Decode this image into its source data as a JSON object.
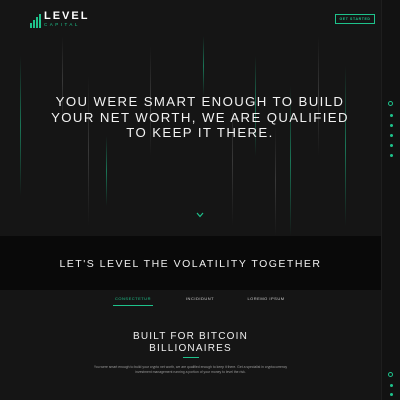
{
  "brand": {
    "name": "LEVEL",
    "tagline": "CAPITAL",
    "accent": "#1ec28b",
    "background": "#151515",
    "band_background": "#090909"
  },
  "header": {
    "cta_label": "GET STARTED"
  },
  "hero": {
    "title": "YOU WERE SMART ENOUGH TO BUILD YOUR NET WORTH, WE ARE QUALIFIED TO KEEP IT THERE.",
    "scroll_icon": "chevron-down-icon"
  },
  "band": {
    "title": "LET'S LEVEL THE VOLATILITY TOGETHER"
  },
  "tabs": [
    {
      "label": "CONSECTETUR",
      "active": true
    },
    {
      "label": "INCIDIDUNT",
      "active": false
    },
    {
      "label": "LOREMO IPSUM",
      "active": false
    }
  ],
  "section": {
    "title_line1": "BUILT FOR BITCOIN",
    "title_line2": "BILLIONAIRES",
    "body": "You were smart enough to build your crypto net worth, we are qualified enough to keep it there. Get a specialist in cryptocurrency investment management running a portion of your money to level the risk."
  },
  "scroll_nav": {
    "icon": "page-dot-icon"
  }
}
